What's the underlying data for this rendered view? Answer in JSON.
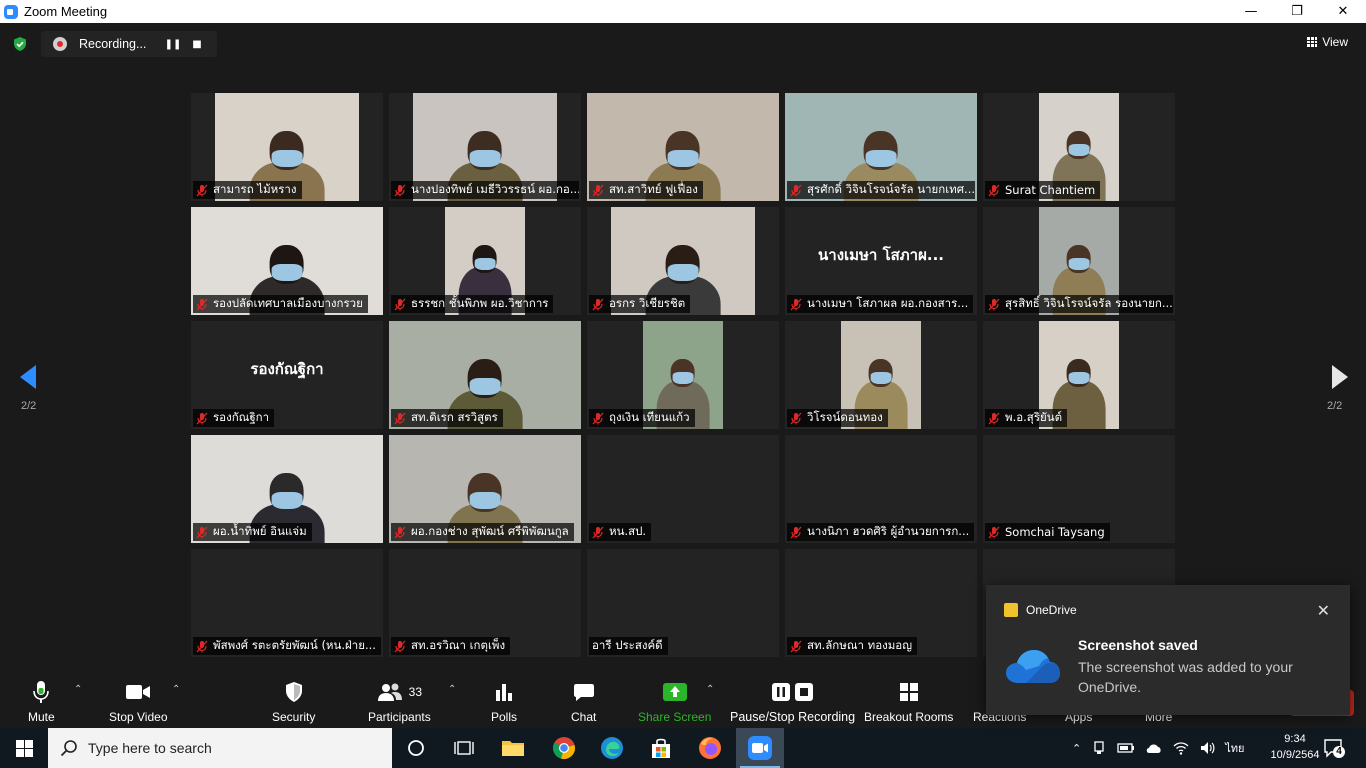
{
  "window": {
    "title": "Zoom Meeting"
  },
  "recording": {
    "label": "Recording..."
  },
  "view": {
    "label": "View"
  },
  "pagination": {
    "left": "2/2",
    "right": "2/2"
  },
  "tiles": [
    {
      "name": "สามารถ ไม้หราง",
      "video": true,
      "bg": "#d9d2c8",
      "head": "#3a2a20",
      "body": "#8a7450"
    },
    {
      "name": "นางปองทิพย์ เมธีวิวรรธน์ ผอ.กอ...",
      "video": true,
      "bg": "#c9c4c0",
      "head": "#3c2c22",
      "body": "#6a6040"
    },
    {
      "name": "สท.สาวิทย์ ฟูเฟื่อง",
      "video": true,
      "bg": "#c2b9ac",
      "head": "#4a3426",
      "body": "#8b7a52"
    },
    {
      "name": "สุรศักดิ์ วิจินโรจน์จรัล นายกเทศ...",
      "video": true,
      "bg": "#9fb6b4",
      "head": "#4a3426",
      "body": "#9a8a60"
    },
    {
      "name": "Surat Chantiem",
      "video": true,
      "bg": "#d6d2cb",
      "head": "#4a3426",
      "body": "#7f7458"
    },
    {
      "name": "รองปลัดเทศบาลเมืองบางกรวย",
      "video": true,
      "bg": "#e0ddd8",
      "head": "#1e1612",
      "body": "#2e2a2a"
    },
    {
      "name": "ธรรชก ชั้นพิภพ ผอ.วิชาการ",
      "video": true,
      "bg": "#d3cdc6",
      "head": "#1e1612",
      "body": "#3a2f3e"
    },
    {
      "name": "อรกร วิเชียรชิต",
      "video": true,
      "bg": "#cfc9c1",
      "head": "#2a1d16",
      "body": "#3a3a3a"
    },
    {
      "name": "นางเมษา โสภาผล ผอ.กองสาร...",
      "video": false,
      "bigname": "นางเมษา โสภาผ..."
    },
    {
      "name": "สุรสิทธิ์ วิจินโรจน์จรัล รองนายก...",
      "video": true,
      "bg": "#a6aaa6",
      "head": "#4a3426",
      "body": "#8f7d55"
    },
    {
      "name": "รองกัณฐิกา",
      "video": false,
      "bigname": "รองกัณฐิกา"
    },
    {
      "name": "สท.ดิเรก สรวิสูตร",
      "video": true,
      "bg": "#a9aea4",
      "head": "#2a1d16",
      "body": "#5d5a38"
    },
    {
      "name": "ถุงเงิน เทียนแก้ว",
      "video": true,
      "bg": "#8ea48a",
      "head": "#4a3426",
      "body": "#6f6a5a"
    },
    {
      "name": "วิโรจน์ดอนทอง",
      "video": true,
      "bg": "#c7c1b6",
      "head": "#4a3426",
      "body": "#9a8a5c"
    },
    {
      "name": "พ.อ.สุริยันต์",
      "video": true,
      "bg": "#d6d0c6",
      "head": "#3a2a20",
      "body": "#6c6040"
    },
    {
      "name": "ผอ.น้ำทิพย์ อินแจ่ม",
      "video": true,
      "bg": "#dedcd8",
      "head": "#2a2a2a",
      "body": "#2a2a30"
    },
    {
      "name": "ผอ.กองช่าง สุพัฒน์ ศรีพิพัฒนกูล",
      "video": true,
      "bg": "#b7b6b0",
      "head": "#4a3426",
      "body": "#7f7350"
    },
    {
      "name": "หน.สป.",
      "video": false
    },
    {
      "name": "นางนิภา ฮวดศิริ ผู้อำนวยการก...",
      "video": false
    },
    {
      "name": "Somchai Taysang",
      "video": false
    },
    {
      "name": "พัสพงศ์ รตะตรัยพัฒน์ (หน.ฝ่าย...",
      "video": false
    },
    {
      "name": "สท.อรวิณา เกตุเพ็ง",
      "video": false
    },
    {
      "name": "อารี ประสงค์ดี",
      "video": false,
      "unmuted": true
    },
    {
      "name": "สท.ลักษณา ทองมอญ",
      "video": false
    },
    {
      "name": "",
      "video": false
    }
  ],
  "toolbar": {
    "mute": "Mute",
    "stop_video": "Stop Video",
    "security": "Security",
    "participants": "Participants",
    "participants_count": "33",
    "polls": "Polls",
    "chat": "Chat",
    "share_screen": "Share Screen",
    "pause_stop_recording": "Pause/Stop Recording",
    "breakout_rooms": "Breakout Rooms",
    "reactions": "Reactions",
    "apps": "Apps",
    "more": "More"
  },
  "toast": {
    "app": "OneDrive",
    "heading": "Screenshot saved",
    "message": "The screenshot was added to your OneDrive."
  },
  "taskbar": {
    "search_placeholder": "Type here to search",
    "language": "ไทย",
    "time": "9:34",
    "date": "10/9/2564",
    "notification_count": "4"
  },
  "colors": {
    "share_green": "#2bb52b",
    "zoom_blue": "#2d8cff",
    "muted_red": "#e02828"
  }
}
